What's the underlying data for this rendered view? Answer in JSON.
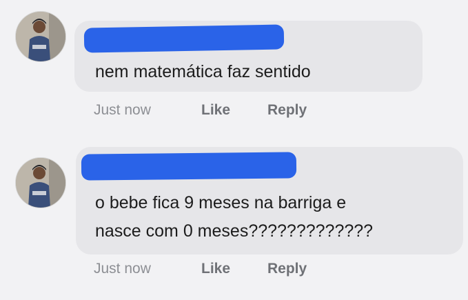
{
  "comments": [
    {
      "text_lines": [
        "nem matemática faz sentido"
      ],
      "time": "Just now",
      "like_label": "Like",
      "reply_label": "Reply"
    },
    {
      "text_lines": [
        "o bebe fica 9 meses na barriga e",
        "nasce com 0 meses?????????????"
      ],
      "time": "Just now",
      "like_label": "Like",
      "reply_label": "Reply"
    }
  ],
  "colors": {
    "redaction": "#2a63e8",
    "bubble": "#e6e6e9",
    "background": "#f2f2f4"
  },
  "icons": [
    "avatar-photo",
    "avatar-photo"
  ]
}
